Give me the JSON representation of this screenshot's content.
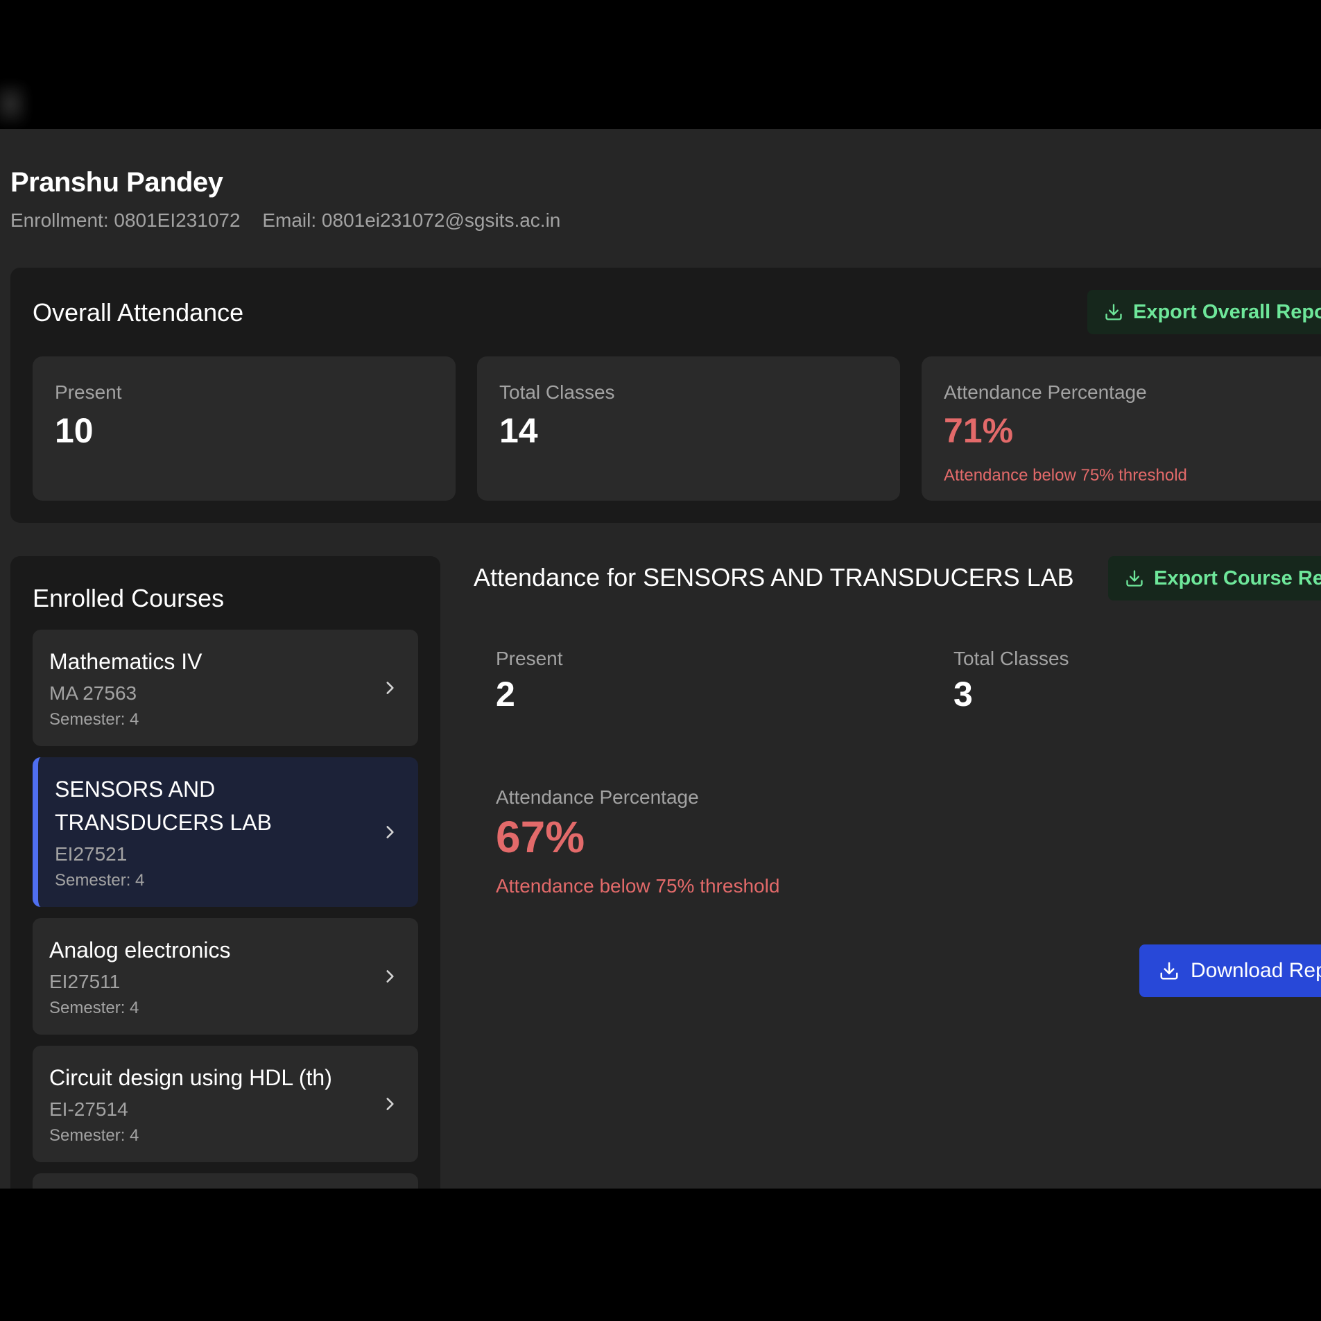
{
  "student": {
    "name": "Pranshu Pandey",
    "enrollment": "Enrollment: 0801EI231072",
    "email": "Email: 0801ei231072@sgsits.ac.in"
  },
  "overall": {
    "title": "Overall Attendance",
    "export_label": "Export Overall Report",
    "present_label": "Present",
    "present_value": "10",
    "total_label": "Total Classes",
    "total_value": "14",
    "percent_label": "Attendance Percentage",
    "percent_value": "71%",
    "warning": "Attendance below 75% threshold"
  },
  "courses": {
    "title": "Enrolled Courses",
    "items": [
      {
        "name": "Mathematics IV",
        "code": "MA 27563",
        "semester": "Semester: 4"
      },
      {
        "name_line1": "SENSORS AND",
        "name_line2": "TRANSDUCERS LAB",
        "code": "EI27521",
        "semester": "Semester: 4"
      },
      {
        "name": "Analog electronics",
        "code": "EI27511",
        "semester": "Semester: 4"
      },
      {
        "name": "Circuit design using HDL (th)",
        "code": "EI-27514",
        "semester": "Semester: 4"
      }
    ]
  },
  "detail": {
    "title": "Attendance for SENSORS AND TRANSDUCERS LAB",
    "export_label": "Export Course Report",
    "present_label": "Present",
    "present_value": "2",
    "total_label": "Total Classes",
    "total_value": "3",
    "percent_label": "Attendance Percentage",
    "percent_value": "67%",
    "warning": "Attendance below 75% threshold",
    "download_label": "Download Report"
  },
  "colors": {
    "accent_blue": "#2848d8",
    "warning_red": "#e36a6a",
    "export_green": "#6ee79a"
  }
}
